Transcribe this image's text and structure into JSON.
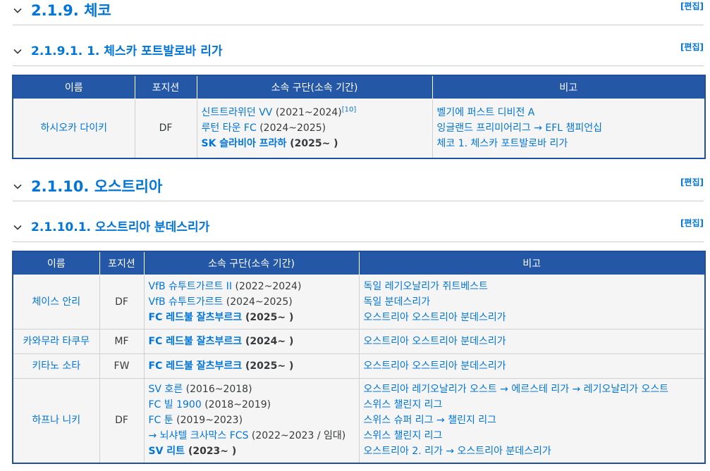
{
  "sections": [
    {
      "number": "2.1.9.",
      "title": "체코",
      "edit": "[편집]"
    },
    {
      "number": "2.1.9.1.",
      "title": "1. 체스카 포트발로바 리가",
      "edit": "[편집]"
    },
    {
      "number": "2.1.10.",
      "title": "오스트리아",
      "edit": "[편집]"
    },
    {
      "number": "2.1.10.1.",
      "title": "오스트리아 분데스리가",
      "edit": "[편집]"
    }
  ],
  "headers": {
    "name": "이름",
    "position": "포지션",
    "club": "소속 구단(소속 기간)",
    "note": "비고"
  },
  "czech": {
    "rows": [
      {
        "name": "하시오카 다이키",
        "position": "DF",
        "clubs": [
          {
            "club": "신트트라위던 VV",
            "period": "(2021~2024)",
            "ref": "[10]"
          },
          {
            "club": "루턴 타운 FC",
            "period": "(2024~2025)"
          },
          {
            "club": "SK 슬라비아 프라하",
            "period": "(2025~ )"
          }
        ],
        "notes": [
          "벨기에 퍼스트 디비전 A",
          "잉글랜드 프리미어리그 → EFL 챔피언십",
          "체코 1. 체스카 포트발로바 리가"
        ]
      }
    ]
  },
  "austria": {
    "rows": [
      {
        "name": "체이스 안리",
        "position": "DF",
        "clubs": [
          {
            "club": "VfB 슈투트가르트 II",
            "period": "(2022~2024)"
          },
          {
            "club": "VfB 슈투트가르트",
            "period": "(2024~2025)"
          },
          {
            "club": "FC 레드불 잘츠부르크",
            "period": "(2025~ )"
          }
        ],
        "notes": [
          "독일 레기오날리가 쥐트베스트",
          "독일 분데스리가",
          "오스트리아 오스트리아 분데스리가"
        ]
      },
      {
        "name": "카와무라 타쿠무",
        "position": "MF",
        "clubs": [
          {
            "club": "FC 레드불 잘츠부르크",
            "period": "(2024~ )"
          }
        ],
        "notes": [
          "오스트리아 오스트리아 분데스리가"
        ]
      },
      {
        "name": "키타노 소타",
        "position": "FW",
        "clubs": [
          {
            "club": "FC 레드불 잘츠부르크",
            "period": "(2025~ )"
          }
        ],
        "notes": [
          "오스트리아 오스트리아 분데스리가"
        ]
      },
      {
        "name": "하프나 니키",
        "position": "DF",
        "clubs": [
          {
            "club": "SV 호른",
            "period": "(2016~2018)"
          },
          {
            "club": "FC 빌 1900",
            "period": "(2018~2019)"
          },
          {
            "club": "FC 툰",
            "period": "(2019~2023)"
          },
          {
            "club": "→ 뇌샤텔 크사막스 FCS",
            "period": "(2022~2023 / 임대)"
          },
          {
            "club": "SV 리트",
            "period": "(2023~ )"
          }
        ],
        "notes": [
          "오스트리아 레기오날리가 오스트 → 에르스테 리가 → 레기오날리가 오스트",
          "스위스 챌린지 리그",
          "스위스 슈퍼 리그 → 챌린지 리그",
          "스위스 챌린지 리그",
          "오스트리아 2. 리가 → 오스트리아 분데스리가"
        ]
      }
    ]
  }
}
